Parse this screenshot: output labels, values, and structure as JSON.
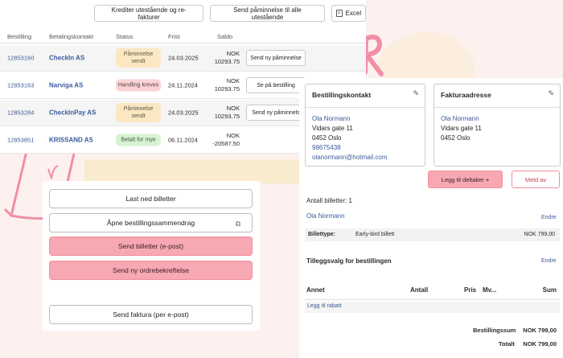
{
  "top_actions": {
    "credit_label": "Krediter utestående og re-fakturer",
    "reminder_all_label": "Send påminnelse til alle utestående",
    "excel_label": "Excel",
    "excel_icon": "excel-icon"
  },
  "table": {
    "headers": [
      "Bestilling",
      "Betalingskontakt",
      "Status",
      "Frist",
      "Saldo"
    ],
    "rows": [
      {
        "number": "12853160",
        "contact": "CheckIn AS",
        "status": "Påminnelse sendt",
        "status_color": "#fbe8c2",
        "due": "24.03.2025",
        "saldo_currency": "NOK",
        "saldo_amount": "10293.75",
        "action": "Send ny påminnelse"
      },
      {
        "number": "12853163",
        "contact": "Narviga AS",
        "status": "Handling kreves",
        "status_color": "#fbd3d6",
        "due": "24.11.2024",
        "saldo_currency": "NOK",
        "saldo_amount": "10293.75",
        "action": "Se på bestilling"
      },
      {
        "number": "12853284",
        "contact": "CheckInPay AS",
        "status": "Påminnelse sendt",
        "status_color": "#fbe8c2",
        "due": "24.03.2025",
        "saldo_currency": "NOK",
        "saldo_amount": "10293.75",
        "action": "Send ny påminnels"
      },
      {
        "number": "12853851",
        "contact": "KRISSAND AS",
        "status": "Betalt for mye",
        "status_color": "#d8f2d3",
        "due": "06.11.2024",
        "saldo_currency": "NOK",
        "saldo_amount": "-20587.50",
        "action": ""
      }
    ]
  },
  "actions": {
    "download": "Last ned billetter",
    "open_summary": "Åpne bestillingssammendrag",
    "send_tickets": "Send billetter (e-post)",
    "send_confirmation": "Send ny ordrebekreftelse",
    "send_invoice": "Send faktura (per e-post)"
  },
  "booking": {
    "contact_card": {
      "title": "Bestillingskontakt",
      "name": "Ola Normann",
      "street": "Vidars gate 11",
      "city": "0452 Oslo",
      "phone": "98675438",
      "email": "olanormann@hotmail.com"
    },
    "invoice_card": {
      "title": "Fakturaadresse",
      "name": "Ola Normann",
      "street": "Vidars gate 11",
      "city": "0452 Oslo"
    },
    "add_participant": "Legg til deltaker +",
    "cancel": "Meld av",
    "ticket_count": "Antall billetter: 1",
    "participant_name": "Ola Normann",
    "edit": "Endre",
    "ticket_type_label": "Billettype:",
    "ticket_type_value": "Early-bird billett",
    "ticket_price": "NOK 799,00",
    "extras_title": "Tilleggsvalg for bestillingen",
    "extras_edit": "Endre",
    "other_headers": [
      "Annet",
      "Antall",
      "Pris",
      "Mv...",
      "Sum"
    ],
    "add_discount": "Legg til rabatt",
    "order_sum_label": "Bestillingssum",
    "order_sum_value": "NOK 799,00",
    "total_label": "Totalt",
    "total_value": "NOK 799,00"
  },
  "colors": {
    "accent_pink": "#f7a8b2",
    "link_blue": "#3c5a9c",
    "background": "#fdf1ef"
  }
}
